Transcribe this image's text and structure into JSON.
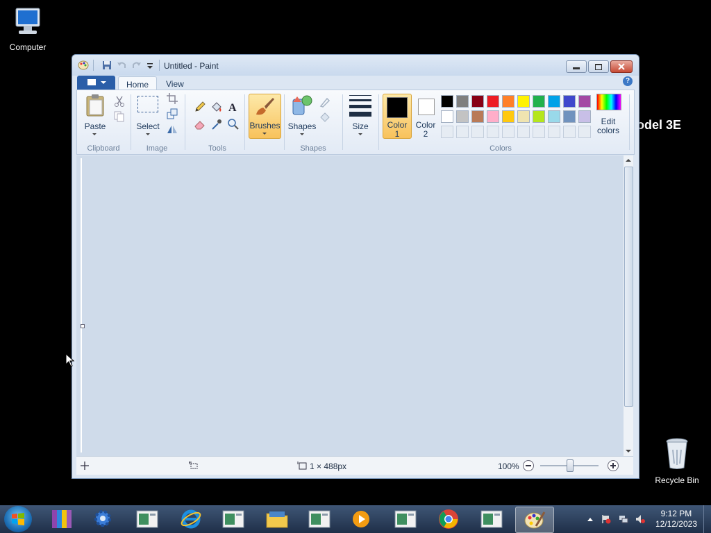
{
  "desktop": {
    "computer_label": "Computer",
    "recycle_label": "Recycle Bin",
    "bg_text": "odel 3E"
  },
  "window": {
    "title": "Untitled - Paint"
  },
  "tabs": [
    {
      "label": "Home"
    },
    {
      "label": "View"
    }
  ],
  "ribbon": {
    "paste": "Paste",
    "select": "Select",
    "brushes": "Brushes",
    "shapes": "Shapes",
    "size": "Size",
    "color1_a": "Color",
    "color1_b": "1",
    "color2_a": "Color",
    "color2_b": "2",
    "edit_colors_a": "Edit",
    "edit_colors_b": "colors",
    "groups": {
      "clipboard": "Clipboard",
      "image": "Image",
      "tools": "Tools",
      "shapes": "Shapes",
      "colors": "Colors"
    }
  },
  "palette": {
    "row1": [
      "#000000",
      "#7f7f7f",
      "#880015",
      "#ed1c24",
      "#ff7f27",
      "#fff200",
      "#22b14c",
      "#00a2e8",
      "#3f48cc",
      "#a349a4"
    ],
    "row2": [
      "#ffffff",
      "#c3c3c3",
      "#b97a57",
      "#ffaec9",
      "#ffc90e",
      "#efe4b0",
      "#b5e61d",
      "#99d9ea",
      "#7092be",
      "#c8bfe7"
    ],
    "color1": "#000000",
    "color2": "#ffffff"
  },
  "status": {
    "canvas_size": "1 × 488px",
    "zoom": "100%"
  },
  "taskbar": {
    "time": "9:12 PM",
    "date": "12/12/2023"
  }
}
